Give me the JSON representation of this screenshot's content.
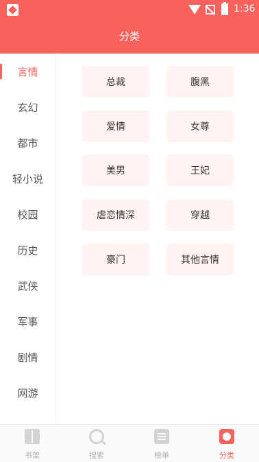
{
  "status_bar": {
    "time": "1:36"
  },
  "header": {
    "title": "分类"
  },
  "sidebar": {
    "items": [
      {
        "label": "言情"
      },
      {
        "label": "玄幻"
      },
      {
        "label": "都市"
      },
      {
        "label": "轻小说"
      },
      {
        "label": "校园"
      },
      {
        "label": "历史"
      },
      {
        "label": "武侠"
      },
      {
        "label": "军事"
      },
      {
        "label": "剧情"
      },
      {
        "label": "网游"
      }
    ],
    "selected": "言情"
  },
  "tags": [
    {
      "label": "总裁"
    },
    {
      "label": "腹黑"
    },
    {
      "label": "爱情"
    },
    {
      "label": "女尊"
    },
    {
      "label": "美男"
    },
    {
      "label": "王妃"
    },
    {
      "label": "虐恋情深"
    },
    {
      "label": "穿越"
    },
    {
      "label": "豪门"
    },
    {
      "label": "其他言情"
    }
  ],
  "tabbar": {
    "tabs": [
      {
        "label": "书架",
        "icon": "bookshelf-icon"
      },
      {
        "label": "搜索",
        "icon": "search-icon"
      },
      {
        "label": "榜单",
        "icon": "ranking-icon"
      },
      {
        "label": "分类",
        "icon": "category-icon"
      }
    ],
    "active": "分类"
  },
  "colors": {
    "accent": "#f8615c",
    "tag_bg": "#fff4f2"
  }
}
